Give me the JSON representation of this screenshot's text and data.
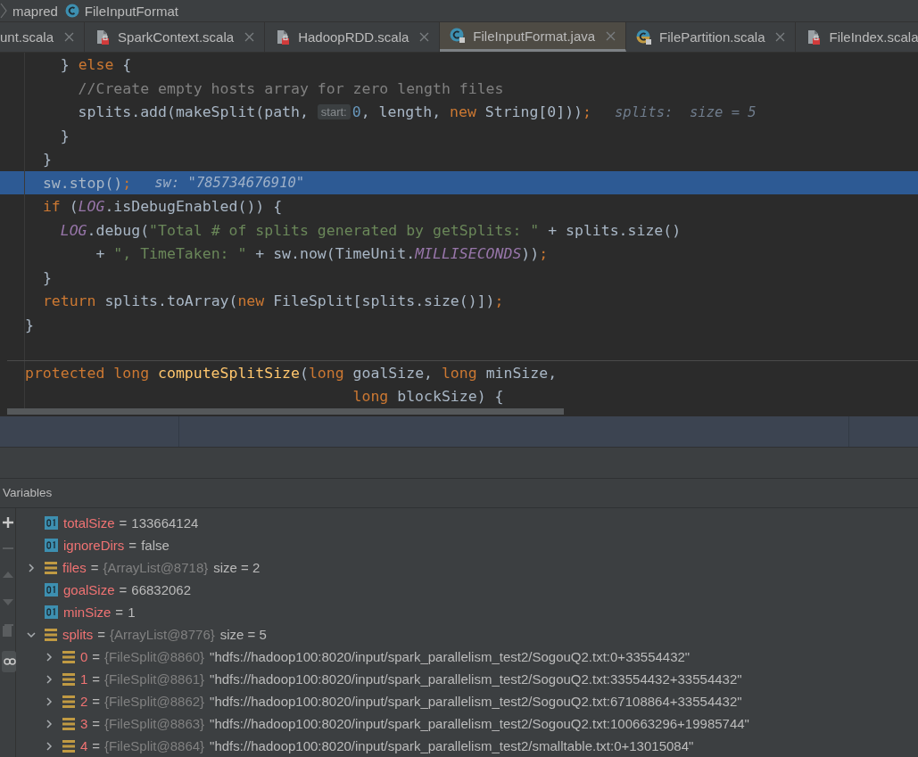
{
  "breadcrumb": [
    {
      "label": "mapred",
      "kind": "package"
    },
    {
      "label": "FileInputFormat",
      "kind": "class"
    }
  ],
  "tabs": [
    {
      "label": "unt.scala",
      "kind": "cut",
      "selected": false,
      "closable": true
    },
    {
      "label": "SparkContext.scala",
      "kind": "file",
      "selected": false,
      "closable": true
    },
    {
      "label": "HadoopRDD.scala",
      "kind": "file",
      "selected": false,
      "closable": true
    },
    {
      "label": "FileInputFormat.java",
      "kind": "javaclass",
      "selected": true,
      "closable": true
    },
    {
      "label": "FilePartition.scala",
      "kind": "scalaclass",
      "selected": false,
      "closable": true
    },
    {
      "label": "FileIndex.scala",
      "kind": "file",
      "selected": false,
      "closable": false
    }
  ],
  "code": {
    "lines": [
      {
        "current": false,
        "separator": false,
        "tokens": [
          {
            "text": "    } ",
            "kind": "plain"
          },
          {
            "text": "else",
            "kind": "kw"
          },
          {
            "text": " {",
            "kind": "plain"
          }
        ]
      },
      {
        "current": false,
        "separator": false,
        "tokens": [
          {
            "text": "      //Create empty hosts array for zero length files",
            "kind": "comment"
          }
        ]
      },
      {
        "current": false,
        "separator": false,
        "tokens": [
          {
            "text": "      splits.add(makeSplit(path, ",
            "kind": "plain"
          },
          {
            "text": "start:",
            "kind": "hint"
          },
          {
            "text": "0",
            "kind": "num"
          },
          {
            "text": ", length, ",
            "kind": "plain"
          },
          {
            "text": "new",
            "kind": "kw"
          },
          {
            "text": " String[0]))",
            "kind": "plain"
          },
          {
            "text": ";",
            "kind": "kw"
          },
          {
            "text": "splits:  size = 5",
            "kind": "debug"
          }
        ]
      },
      {
        "current": false,
        "separator": false,
        "tokens": [
          {
            "text": "    }",
            "kind": "plain"
          }
        ]
      },
      {
        "current": false,
        "separator": false,
        "tokens": [
          {
            "text": "  }",
            "kind": "plain"
          }
        ]
      },
      {
        "current": true,
        "separator": false,
        "tokens": [
          {
            "text": "  sw.stop()",
            "kind": "plain"
          },
          {
            "text": ";",
            "kind": "kw"
          },
          {
            "text": "sw: \"785734676910\"",
            "kind": "debug"
          }
        ]
      },
      {
        "current": false,
        "separator": false,
        "tokens": [
          {
            "text": "  if",
            "kind": "kw"
          },
          {
            "text": " (",
            "kind": "plain"
          },
          {
            "text": "LOG",
            "kind": "static"
          },
          {
            "text": ".isDebugEnabled()) {",
            "kind": "plain"
          }
        ]
      },
      {
        "current": false,
        "separator": false,
        "tokens": [
          {
            "text": "    LOG",
            "kind": "static"
          },
          {
            "text": ".debug(",
            "kind": "plain"
          },
          {
            "text": "\"Total # of splits generated by getSplits: \"",
            "kind": "str"
          },
          {
            "text": " + splits.size()",
            "kind": "plain"
          }
        ]
      },
      {
        "current": false,
        "separator": false,
        "tokens": [
          {
            "text": "        + ",
            "kind": "plain"
          },
          {
            "text": "\", TimeTaken: \"",
            "kind": "str"
          },
          {
            "text": " + sw.now(TimeUnit.",
            "kind": "plain"
          },
          {
            "text": "MILLISECONDS",
            "kind": "static"
          },
          {
            "text": "))",
            "kind": "plain"
          },
          {
            "text": ";",
            "kind": "kw"
          }
        ]
      },
      {
        "current": false,
        "separator": false,
        "tokens": [
          {
            "text": "  }",
            "kind": "plain"
          }
        ]
      },
      {
        "current": false,
        "separator": false,
        "tokens": [
          {
            "text": "  return",
            "kind": "kw"
          },
          {
            "text": " splits.toArray(",
            "kind": "plain"
          },
          {
            "text": "new",
            "kind": "kw"
          },
          {
            "text": " FileSplit[splits.size()])",
            "kind": "plain"
          },
          {
            "text": ";",
            "kind": "kw"
          }
        ]
      },
      {
        "current": false,
        "separator": false,
        "tokens": [
          {
            "text": "}",
            "kind": "plain"
          }
        ]
      },
      {
        "current": false,
        "separator": false
      },
      {
        "current": false,
        "separator": true,
        "tokens": [
          {
            "text": "protected long ",
            "kind": "kw"
          },
          {
            "text": "computeSplitSize",
            "kind": "fn"
          },
          {
            "text": "(",
            "kind": "plain"
          },
          {
            "text": "long",
            "kind": "kw"
          },
          {
            "text": " goalSize, ",
            "kind": "plain"
          },
          {
            "text": "long",
            "kind": "kw"
          },
          {
            "text": " minSize,",
            "kind": "plain"
          }
        ]
      },
      {
        "current": false,
        "separator": false,
        "tokens": [
          {
            "text": "                                     long",
            "kind": "kw"
          },
          {
            "text": " blockSize) {",
            "kind": "plain"
          }
        ]
      }
    ]
  },
  "variables_panel": {
    "title": "Variables",
    "variables": [
      {
        "kind": "primitive",
        "name": "totalSize",
        "equals": "=",
        "value": "133664124"
      },
      {
        "kind": "primitive",
        "name": "ignoreDirs",
        "equals": "=",
        "value": "false"
      },
      {
        "kind": "object",
        "name": "files",
        "equals": "=",
        "ref": "{ArrayList@8718}",
        "value": "size = 2",
        "expanded": false
      },
      {
        "kind": "primitive",
        "name": "goalSize",
        "equals": "=",
        "value": "66832062"
      },
      {
        "kind": "primitive",
        "name": "minSize",
        "equals": "=",
        "value": "1"
      },
      {
        "kind": "object",
        "name": "splits",
        "equals": "=",
        "ref": "{ArrayList@8776}",
        "value": "size = 5",
        "expanded": true,
        "children": [
          {
            "kind": "object",
            "name": "0",
            "equals": "=",
            "ref": "{FileSplit@8860}",
            "value": "\"hdfs://hadoop100:8020/input/spark_parallelism_test2/SogouQ2.txt:0+33554432\"",
            "expanded": false
          },
          {
            "kind": "object",
            "name": "1",
            "equals": "=",
            "ref": "{FileSplit@8861}",
            "value": "\"hdfs://hadoop100:8020/input/spark_parallelism_test2/SogouQ2.txt:33554432+33554432\"",
            "expanded": false
          },
          {
            "kind": "object",
            "name": "2",
            "equals": "=",
            "ref": "{FileSplit@8862}",
            "value": "\"hdfs://hadoop100:8020/input/spark_parallelism_test2/SogouQ2.txt:67108864+33554432\"",
            "expanded": false
          },
          {
            "kind": "object",
            "name": "3",
            "equals": "=",
            "ref": "{FileSplit@8863}",
            "value": "\"hdfs://hadoop100:8020/input/spark_parallelism_test2/SogouQ2.txt:100663296+19985744\"",
            "expanded": false
          },
          {
            "kind": "object",
            "name": "4",
            "equals": "=",
            "ref": "{FileSplit@8864}",
            "value": "\"hdfs://hadoop100:8020/input/spark_parallelism_test2/smalltable.txt:0+13015084\"",
            "expanded": false
          }
        ]
      }
    ]
  }
}
